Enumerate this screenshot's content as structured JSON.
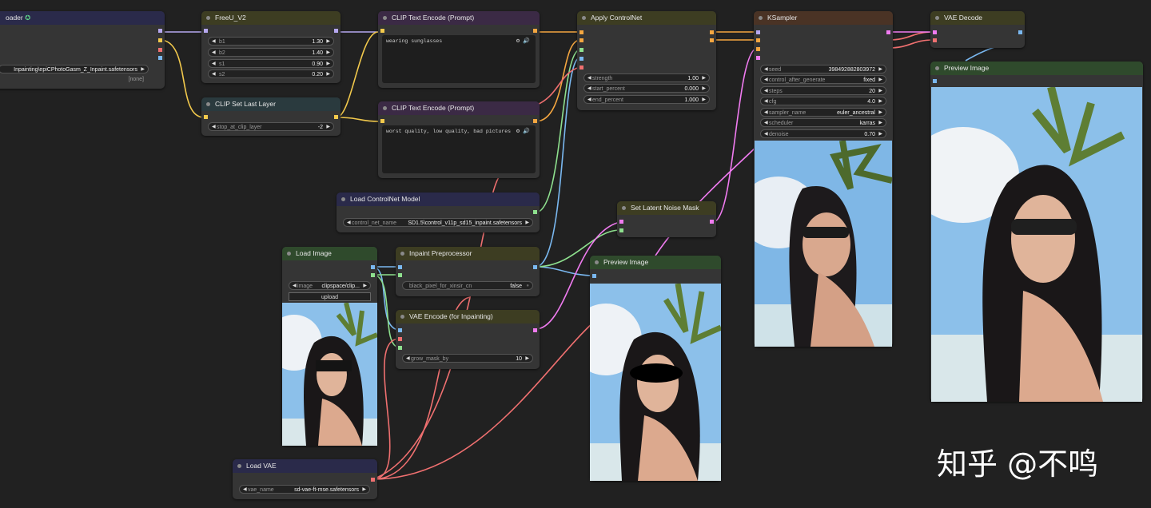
{
  "nodes": {
    "checkpoint": {
      "title": "oader",
      "value": "Inpainting\\epiCPhotoGasm_Z_Inpaint.safetensors",
      "none_value": "[none]"
    },
    "freeu": {
      "title": "FreeU_V2",
      "params": [
        {
          "label": "b1",
          "value": "1.30"
        },
        {
          "label": "b2",
          "value": "1.40"
        },
        {
          "label": "s1",
          "value": "0.90"
        },
        {
          "label": "s2",
          "value": "0.20"
        }
      ]
    },
    "clip_last": {
      "title": "CLIP Set Last Layer",
      "label": "stop_at_clip_layer",
      "value": "-2"
    },
    "clip_pos": {
      "title": "CLIP Text Encode (Prompt)",
      "text": "wearing sunglasses"
    },
    "clip_neg": {
      "title": "CLIP Text Encode (Prompt)",
      "text": "worst quality, low quality, bad pictures"
    },
    "apply_cn": {
      "title": "Apply ControlNet",
      "params": [
        {
          "label": "strength",
          "value": "1.00"
        },
        {
          "label": "start_percent",
          "value": "0.000"
        },
        {
          "label": "end_percent",
          "value": "1.000"
        }
      ]
    },
    "ksampler": {
      "title": "KSampler",
      "params": [
        {
          "label": "seed",
          "value": "398492882803972"
        },
        {
          "label": "control_after_generate",
          "value": "fixed"
        },
        {
          "label": "steps",
          "value": "20"
        },
        {
          "label": "cfg",
          "value": "4.0"
        },
        {
          "label": "sampler_name",
          "value": "euler_ancestral"
        },
        {
          "label": "scheduler",
          "value": "karras"
        },
        {
          "label": "denoise",
          "value": "0.70"
        }
      ]
    },
    "vae_decode": {
      "title": "VAE Decode"
    },
    "preview_right": {
      "title": "Preview Image"
    },
    "load_cn": {
      "title": "Load ControlNet Model",
      "label": "control_net_name",
      "value": "SD1.5\\control_v11p_sd15_inpaint.safetensors"
    },
    "noise_mask": {
      "title": "Set Latent Noise Mask"
    },
    "load_image": {
      "title": "Load Image",
      "label": "image",
      "value": "clipspace/clip...",
      "upload_label": "upload"
    },
    "inpaint_pre": {
      "title": "Inpaint Preprocessor",
      "label": "black_pixel_for_xinsir_cn",
      "value": "false"
    },
    "vae_encode": {
      "title": "VAE Encode (for Inpainting)",
      "label": "grow_mask_by",
      "value": "10"
    },
    "preview_mid": {
      "title": "Preview Image"
    },
    "load_vae": {
      "title": "Load VAE",
      "label": "vae_name",
      "value": "sd-vae-ft-mse.safetensors"
    }
  },
  "watermark": "知乎 @不鸣",
  "icons": {
    "gear": "gear-icon",
    "speaker": "speaker-icon",
    "left": "arrow-left-icon",
    "right": "arrow-right-icon"
  },
  "colors": {
    "canvas": "#212121",
    "node_body": "#353535",
    "header_blue": "#2a2a4a",
    "header_olive": "#3d3d22",
    "header_purple": "#3b2a45",
    "header_teal": "#2a3a3e",
    "header_brown": "#4a3325",
    "header_green": "#2f4a2c",
    "wire_yellow": "#f2c94c",
    "wire_purple": "#b69cf2",
    "wire_pink": "#f07bf0",
    "wire_red": "#f07070",
    "wire_green": "#90e090",
    "wire_blue": "#7ab8f0"
  }
}
